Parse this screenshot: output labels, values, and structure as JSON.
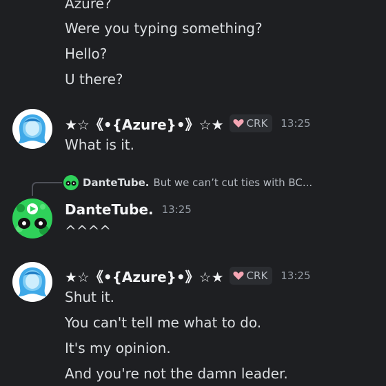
{
  "messages": {
    "first_group": {
      "lines": [
        "Azure?",
        "Were you typing something?",
        "Hello?",
        "U there?"
      ]
    },
    "second_group": {
      "username": "★☆《•{Azure}•》☆★",
      "badge": "CRK",
      "timestamp": "13:25",
      "lines": [
        "What is it."
      ]
    },
    "reply_group": {
      "reply_preview": {
        "username": "DanteTube.",
        "text": "But we can’t cut ties with BC..."
      },
      "username": "DanteTube.",
      "timestamp": "13:25",
      "lines": [
        "^^^^"
      ]
    },
    "fourth_group": {
      "username": "★☆《•{Azure}•》☆★",
      "badge": "CRK",
      "timestamp": "13:25",
      "lines": [
        "Shut it.",
        "You can't tell me what to do.",
        "It's my opinion.",
        "And you're not the damn leader."
      ]
    }
  },
  "colors": {
    "background": "#1e1f22",
    "text": "#dbdee1",
    "username": "#f2f3f5",
    "muted": "#949ba4",
    "badge_bg": "#2b2d31",
    "heart": "#f4a6b4",
    "azure_avatar_blue": "#3fa9e8",
    "dante_avatar_green": "#2fd15a"
  },
  "icons": {
    "badge_icon": "heart-icon",
    "azure_avatar": "azure-avatar",
    "dante_avatar": "dante-avatar"
  }
}
